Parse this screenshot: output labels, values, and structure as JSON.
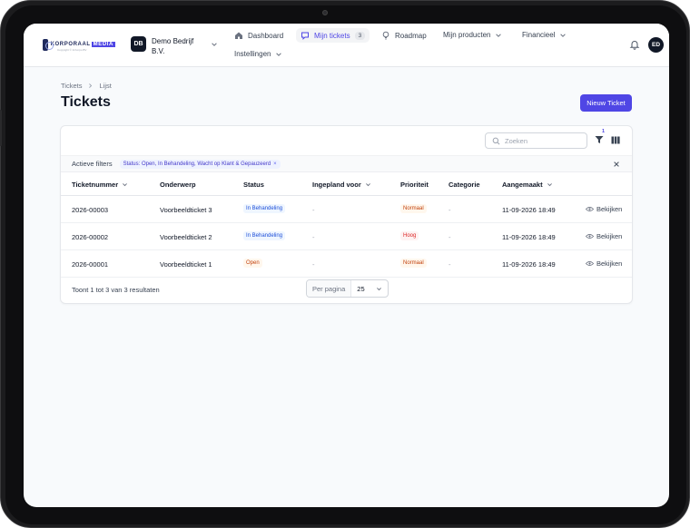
{
  "brand": {
    "logo_main": "KORPORAAL",
    "logo_accent": "MEDIA",
    "logo_sub": "Copyright © & Korpo BV"
  },
  "company": {
    "initials": "DB",
    "name": "Demo Bedrijf B.V."
  },
  "nav": {
    "dashboard": "Dashboard",
    "tickets": "Mijn tickets",
    "tickets_count": "3",
    "roadmap": "Roadmap",
    "products": "Mijn producten",
    "financial": "Financieel",
    "settings": "Instellingen"
  },
  "user": {
    "initials": "ED"
  },
  "breadcrumb": {
    "root": "Tickets",
    "current": "Lijst"
  },
  "page": {
    "title": "Tickets",
    "new_button": "Nieuw Ticket"
  },
  "toolbar": {
    "search_placeholder": "Zoeken",
    "filter_count": "1"
  },
  "filters": {
    "label": "Actieve filters",
    "chip": "Status: Open, In Behandeling, Wacht op Klant & Gepauzeerd"
  },
  "table": {
    "columns": {
      "number": "Ticketnummer",
      "subject": "Onderwerp",
      "status": "Status",
      "planned": "Ingepland voor",
      "priority": "Prioriteit",
      "category": "Categorie",
      "created": "Aangemaakt"
    },
    "view_label": "Bekijken",
    "rows": [
      {
        "number": "2026-00003",
        "subject": "Voorbeeldticket 3",
        "status": "In Behandeling",
        "planned": "-",
        "priority": "Normaal",
        "category": "-",
        "created": "11-09-2026 18:49"
      },
      {
        "number": "2026-00002",
        "subject": "Voorbeeldticket 2",
        "status": "In Behandeling",
        "planned": "-",
        "priority": "Hoog",
        "category": "-",
        "created": "11-09-2026 18:49"
      },
      {
        "number": "2026-00001",
        "subject": "Voorbeeldticket 1",
        "status": "Open",
        "planned": "-",
        "priority": "Normaal",
        "category": "-",
        "created": "11-09-2026 18:49"
      }
    ]
  },
  "footer": {
    "results": "Toont 1 tot 3 van 3 resultaten",
    "per_page_label": "Per pagina",
    "per_page_value": "25"
  },
  "colors": {
    "accent": "#4f46e5",
    "status_blue": "#1d4ed8",
    "priority_orange": "#c2410c",
    "priority_red": "#dc2626"
  }
}
